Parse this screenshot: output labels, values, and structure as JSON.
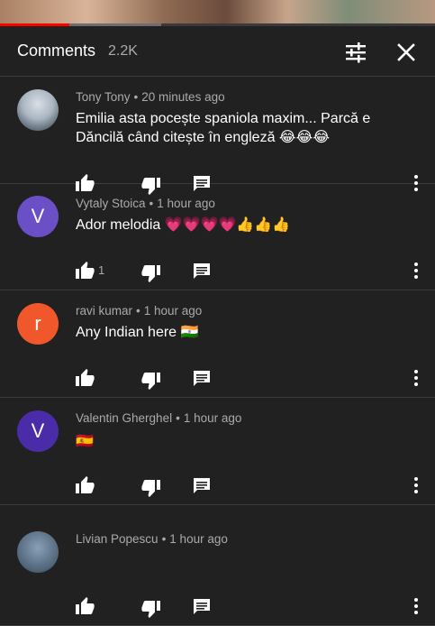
{
  "header": {
    "title": "Comments",
    "count": "2.2K"
  },
  "player": {
    "played_fraction": 0.16,
    "buffered_fraction": 0.37
  },
  "colors": {
    "accent_red": "#ff0000",
    "avatar_purple_1": "#6a4fc7",
    "avatar_orange": "#f0582b",
    "avatar_purple_2": "#4a2ba8"
  },
  "comments": [
    {
      "author": "Tony Tony",
      "time": "20 minutes ago",
      "text": "Emilia asta pocește spaniola maxim... Parcă e Dăncilă când citește în engleză",
      "emojis": "😂😂😂",
      "likes": "",
      "avatar_letter": "",
      "avatar_type": "photo"
    },
    {
      "author": "Vytaly Stoica",
      "time": "1 hour ago",
      "text": "Ador melodia",
      "emojis": "💗💗💗💗👍👍👍",
      "likes": "1",
      "avatar_letter": "V",
      "avatar_type": "letter"
    },
    {
      "author": "ravi kumar",
      "time": "1 hour ago",
      "text": "Any Indian here",
      "emojis": "🇮🇳",
      "likes": "",
      "avatar_letter": "r",
      "avatar_type": "letter"
    },
    {
      "author": "Valentin Gherghel",
      "time": "1 hour ago",
      "text": "",
      "emojis": "🇪🇸",
      "likes": "",
      "avatar_letter": "V",
      "avatar_type": "letter"
    },
    {
      "author": "Livian Popescu",
      "time": "1 hour ago",
      "text": "",
      "emojis": "",
      "likes": "",
      "avatar_letter": "",
      "avatar_type": "photo"
    }
  ],
  "icons": {
    "like": "thumb-up-icon",
    "dislike": "thumb-down-icon",
    "reply": "comment-icon",
    "more": "more-vert-icon",
    "filter": "sort-filter-icon",
    "close": "close-icon"
  }
}
